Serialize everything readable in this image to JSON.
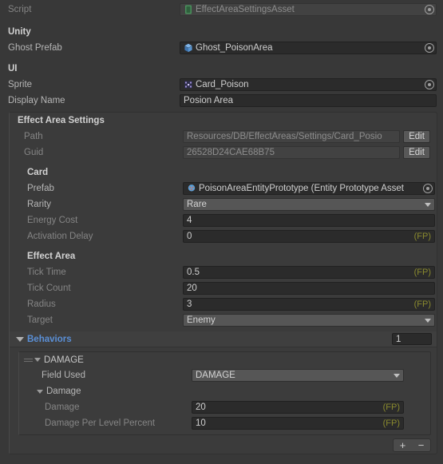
{
  "script_row": {
    "label": "Script",
    "value": "EffectAreaSettingsAsset",
    "icon": "cs-script-icon"
  },
  "sections": {
    "unity": {
      "heading": "Unity",
      "ghost_prefab": {
        "label": "Ghost Prefab",
        "value": "Ghost_PoisonArea",
        "icon": "prefab-cube-icon"
      }
    },
    "ui": {
      "heading": "UI",
      "sprite": {
        "label": "Sprite",
        "value": "Card_Poison",
        "icon": "sprite-icon"
      },
      "display_name": {
        "label": "Display Name",
        "value": "Posion Area"
      }
    },
    "effect_area_settings": {
      "heading": "Effect Area Settings",
      "path": {
        "label": "Path",
        "value": "Resources/DB/EffectAreas/Settings/Card_Posio",
        "button": "Edit"
      },
      "guid": {
        "label": "Guid",
        "value": "26528D24CAE68B75",
        "button": "Edit"
      },
      "card": {
        "heading": "Card",
        "prefab": {
          "label": "Prefab",
          "value": "PoisonAreaEntityPrototype (Entity Prototype Asset",
          "icon": "entity-prototype-icon"
        },
        "rarity": {
          "label": "Rarity",
          "value": "Rare"
        },
        "energy_cost": {
          "label": "Energy Cost",
          "value": "4"
        },
        "activation_delay": {
          "label": "Activation Delay",
          "value": "0",
          "suffix": "(FP)"
        }
      },
      "effect_area": {
        "heading": "Effect Area",
        "tick_time": {
          "label": "Tick Time",
          "value": "0.5",
          "suffix": "(FP)"
        },
        "tick_count": {
          "label": "Tick Count",
          "value": "20"
        },
        "radius": {
          "label": "Radius",
          "value": "3",
          "suffix": "(FP)"
        },
        "target": {
          "label": "Target",
          "value": "Enemy"
        }
      },
      "behaviors": {
        "title": "Behaviors",
        "count": "1",
        "element": {
          "name": "DAMAGE",
          "field_used": {
            "label": "Field Used",
            "value": "DAMAGE"
          },
          "damage_group": {
            "heading": "Damage",
            "damage": {
              "label": "Damage",
              "value": "20",
              "suffix": "(FP)"
            },
            "damage_per_level": {
              "label": "Damage Per Level Percent",
              "value": "10",
              "suffix": "(FP)"
            }
          }
        },
        "add_button": "+",
        "remove_button": "−"
      }
    }
  },
  "colors": {
    "background": "#383838",
    "accent_blue": "#5a8fd6",
    "fp_suffix": "#8a8a2e",
    "field_bg": "#2b2b2b"
  }
}
